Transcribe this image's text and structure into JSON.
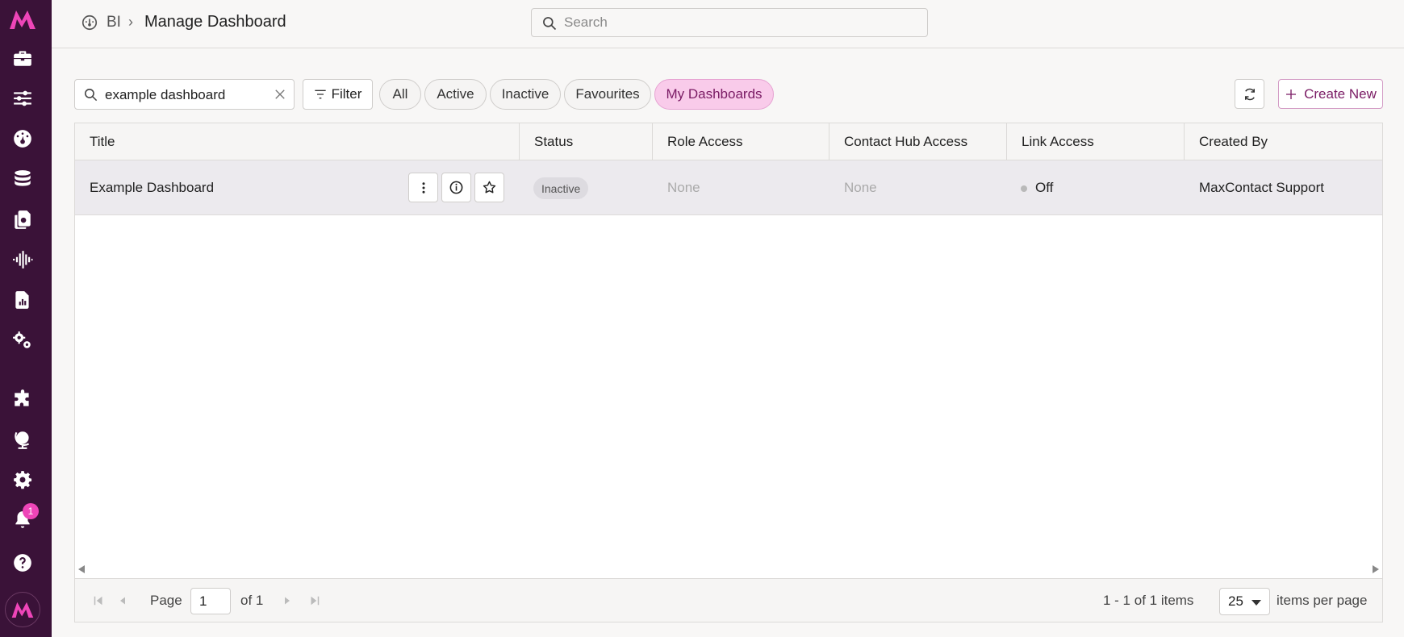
{
  "sidebar": {
    "items": [
      {
        "name": "toolbox-icon"
      },
      {
        "name": "sliders-icon"
      },
      {
        "name": "dashboard-gauge-icon"
      },
      {
        "name": "database-icon"
      },
      {
        "name": "documents-icon"
      },
      {
        "name": "audio-wave-icon"
      },
      {
        "name": "report-chart-icon"
      },
      {
        "name": "gears-icon"
      },
      {
        "name": "puzzle-icon"
      },
      {
        "name": "globe-icon"
      },
      {
        "name": "settings-icon"
      },
      {
        "name": "bell-icon"
      },
      {
        "name": "help-icon"
      }
    ],
    "notification_count": "1",
    "brand_color": "#ee45b8",
    "background": "#3a1238"
  },
  "header": {
    "breadcrumb_root": "BI",
    "breadcrumb_separator": "›",
    "page_title": "Manage Dashboard",
    "search_placeholder": "Search"
  },
  "toolbar": {
    "search_value": "example dashboard",
    "filter_label": "Filter",
    "chips": [
      "All",
      "Active",
      "Inactive",
      "Favourites",
      "My Dashboards"
    ],
    "active_chip": "My Dashboards",
    "create_label": "Create New"
  },
  "grid": {
    "columns": [
      "Title",
      "Status",
      "Role Access",
      "Contact Hub Access",
      "Link Access",
      "Created By"
    ],
    "rows": [
      {
        "title": "Example Dashboard",
        "status": "Inactive",
        "role_access": "None",
        "contact_hub_access": "None",
        "link_access": "Off",
        "created_by": "MaxContact Support"
      }
    ]
  },
  "pager": {
    "page_label": "Page",
    "page_value": "1",
    "of_label": "of 1",
    "summary": "1 - 1 of 1 items",
    "page_size": "25",
    "per_page_label": "items per page"
  }
}
